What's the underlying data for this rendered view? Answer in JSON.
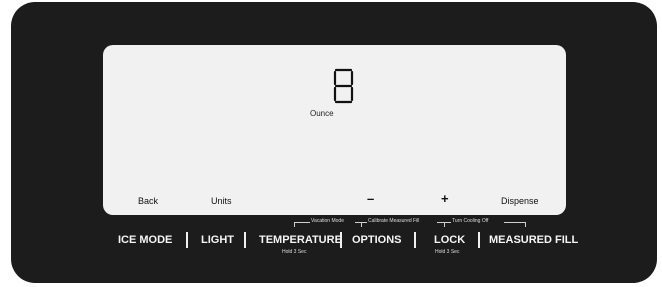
{
  "display": {
    "digit": "8",
    "unit_label": "Ounce"
  },
  "soft_keys": {
    "back": "Back",
    "units": "Units",
    "minus": "–",
    "plus": "+",
    "dispense": "Dispense"
  },
  "hints": {
    "vacation_mode": "Vacation Mode",
    "calibrate": "Calibrate Measured Fill",
    "turn_cooling_off": "Turn Cooling Off"
  },
  "buttons": {
    "ice_mode": "ICE MODE",
    "light": "LIGHT",
    "temperature": "TEMPERATURE",
    "temperature_sub": "Hold 3 Sec",
    "options": "OPTIONS",
    "lock": "LOCK",
    "lock_sub": "Hold 3 Sec",
    "measured_fill": "MEASURED FILL"
  },
  "colors": {
    "bezel": "#1c1c1c",
    "lcd": "#f1f1f1",
    "button_text": "#f5f5f5"
  }
}
